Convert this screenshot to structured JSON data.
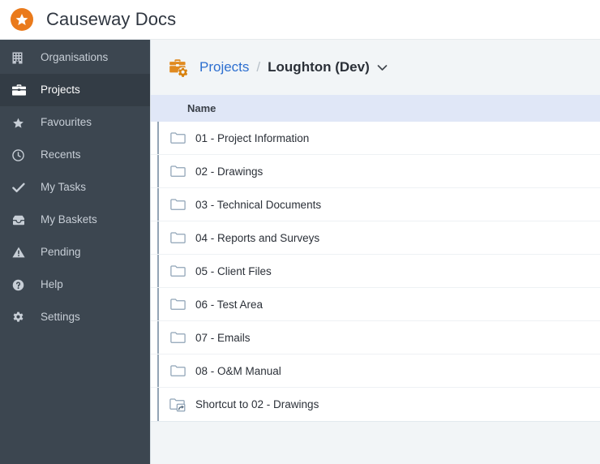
{
  "app": {
    "title": "Causeway Docs",
    "logo_icon": "star-circle-logo",
    "accent_color": "#ea7a1b",
    "sidebar_bg": "#3c4650",
    "link_color": "#2d6fd0",
    "table_header_bg": "#e0e7f7"
  },
  "sidebar": {
    "items": [
      {
        "label": "Organisations",
        "icon": "building-icon",
        "active": false
      },
      {
        "label": "Projects",
        "icon": "briefcase-icon",
        "active": true
      },
      {
        "label": "Favourites",
        "icon": "star-icon",
        "active": false
      },
      {
        "label": "Recents",
        "icon": "clock-icon",
        "active": false
      },
      {
        "label": "My Tasks",
        "icon": "check-icon",
        "active": false
      },
      {
        "label": "My Baskets",
        "icon": "basket-icon",
        "active": false
      },
      {
        "label": "Pending",
        "icon": "warning-icon",
        "active": false
      },
      {
        "label": "Help",
        "icon": "help-icon",
        "active": false
      },
      {
        "label": "Settings",
        "icon": "gear-icon",
        "active": false
      }
    ]
  },
  "breadcrumb": {
    "icon": "briefcase-gear-icon",
    "link_label": "Projects",
    "separator": "/",
    "current_label": "Loughton (Dev)",
    "caret_icon": "chevron-down-icon"
  },
  "table": {
    "columns": [
      "Name"
    ],
    "rows": [
      {
        "name": "01 - Project Information",
        "icon": "folder-icon"
      },
      {
        "name": "02 - Drawings",
        "icon": "folder-icon"
      },
      {
        "name": "03 - Technical Documents",
        "icon": "folder-icon"
      },
      {
        "name": "04 - Reports and Surveys",
        "icon": "folder-icon"
      },
      {
        "name": "05 - Client Files",
        "icon": "folder-icon"
      },
      {
        "name": "06 - Test Area",
        "icon": "folder-icon"
      },
      {
        "name": "07 - Emails",
        "icon": "folder-icon"
      },
      {
        "name": "08 - O&M Manual",
        "icon": "folder-icon"
      },
      {
        "name": "Shortcut to 02 - Drawings",
        "icon": "folder-shortcut-icon"
      }
    ]
  }
}
